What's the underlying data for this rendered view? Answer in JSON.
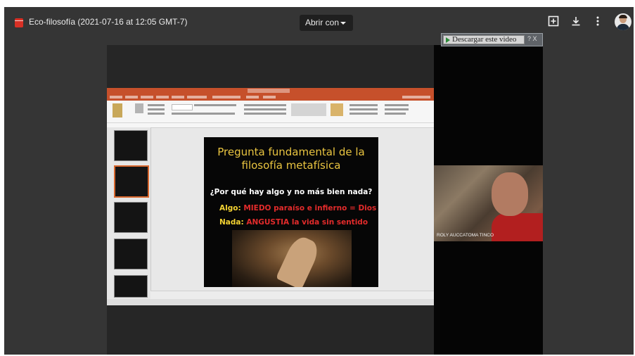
{
  "window": {
    "file_title": "Eco-filosofía (2021-07-16 at 12:05 GMT-7)",
    "open_with_label": "Abrir con",
    "icons": [
      "add-to-drive-icon",
      "download-icon",
      "more-vert-icon",
      "avatar"
    ]
  },
  "download_extension": {
    "button_label": "Descargar este video",
    "extra": "? X"
  },
  "slide": {
    "title": "Pregunta fundamental de la filosofía metafísica",
    "question": "¿Por qué hay algo y no más bien nada?",
    "algo_label": "Algo:",
    "algo_text": "MIEDO paraíso e infierno = Dios",
    "nada_label": "Nada:",
    "nada_text": "ANGUSTIA la vida sin sentido"
  },
  "participant": {
    "name": "ROLY AUCCATOMA TINCO"
  },
  "colors": {
    "background": "#353535",
    "powerpoint_accent": "#c6502b",
    "slide_title": "#e9c440",
    "slide_red": "#e22b2b"
  }
}
